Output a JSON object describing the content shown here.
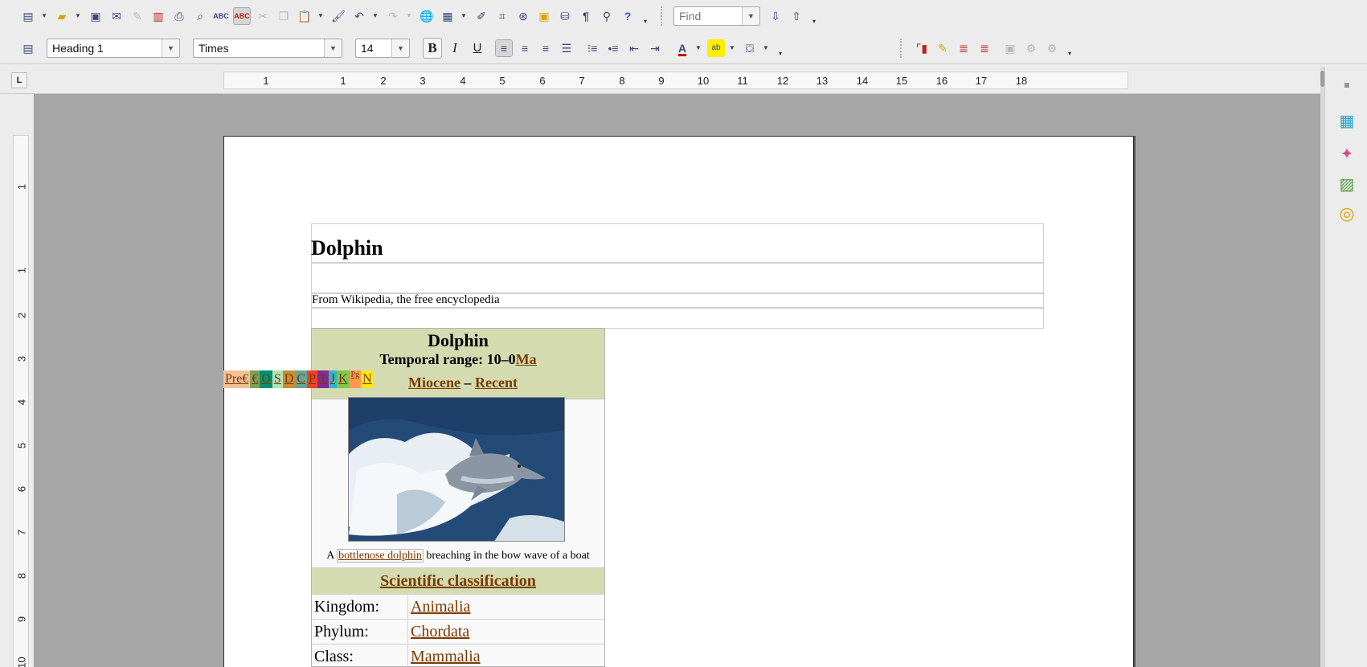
{
  "toolbar1": {
    "find_placeholder": "Find"
  },
  "toolbar2": {
    "paragraph_style": "Heading 1",
    "font_name": "Times",
    "font_size": "14",
    "bold_label": "B",
    "italic_label": "I",
    "underline_label": "U"
  },
  "ruler": {
    "corner_label": "L",
    "h_numbers": [
      "1",
      "1",
      "2",
      "3",
      "4",
      "5",
      "6",
      "7",
      "8",
      "9",
      "10",
      "11",
      "12",
      "13",
      "14",
      "15",
      "16",
      "17",
      "18"
    ],
    "v_numbers": [
      "1",
      "1",
      "2",
      "3",
      "4",
      "5",
      "6",
      "7",
      "8",
      "9",
      "10"
    ]
  },
  "document": {
    "heading": "Dolphin",
    "subtitle": "From Wikipedia, the free encyclopedia",
    "infobox": {
      "title": "Dolphin",
      "temporal_range_label": "Temporal range: 10–0",
      "temporal_range_unit": "Ma",
      "period_start": "Miocene",
      "period_dash": "–",
      "period_end": "Recent",
      "geologic_periods": [
        "Pre€",
        "€",
        "O",
        "S",
        "D",
        "C",
        "P",
        "T",
        "J",
        "K",
        "Pg",
        "N"
      ],
      "caption_pre": "A",
      "caption_link": "bottlenose dolphin",
      "caption_post": "breaching in the bow wave of a boat",
      "classification_header": "Scientific classification",
      "taxonomy": [
        {
          "rank": "Kingdom:",
          "value": "Animalia"
        },
        {
          "rank": "Phylum:",
          "value": "Chordata"
        },
        {
          "rank": "Class:",
          "value": "Mammalia"
        }
      ]
    }
  },
  "colors": {
    "infobox_header": "#d4dbb1",
    "link": "#7a3b00",
    "geo_pre": "#f2c19a",
    "geo_cambrian": "#7fa056",
    "geo_ordovician": "#009270",
    "geo_silurian": "#b3e1b6",
    "geo_devonian": "#cb8c37",
    "geo_carboniferous": "#67a599",
    "geo_permian": "#f04028",
    "geo_triassic": "#812b92",
    "geo_jurassic": "#34b2c9",
    "geo_cretaceous": "#7fc64e",
    "geo_paleogene": "#fd9a52",
    "geo_neogene": "#ffe619"
  }
}
